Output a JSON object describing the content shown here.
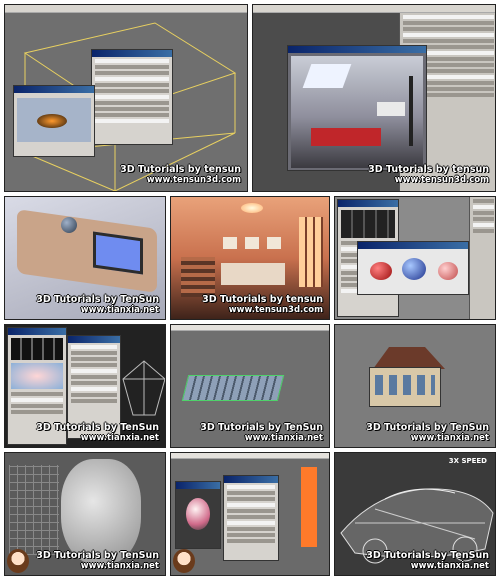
{
  "captions": {
    "t01": {
      "line1": "3D Tutorials by tensun",
      "line2": "www.tensun3d.com"
    },
    "t02": {
      "line1": "3D Tutorials by tensun",
      "line2": "www.tensun3d.com"
    },
    "t03": {
      "line1": "3D Tutorials by TenSun",
      "line2": "www.tianxia.net"
    },
    "t04": {
      "line1": "3D Tutorials by tensun",
      "line2": "www.tensun3d.com"
    },
    "t05": {
      "line1": "3D Tutorials by TenSun",
      "line2": "www.tianxia.net"
    },
    "t06": {
      "line1": "3D Tutorials by TenSun",
      "line2": "www.tianxia.net"
    },
    "t07": {
      "line1": "3D Tutorials by TenSun",
      "line2": "www.tianxia.net"
    },
    "t08": {
      "line1": "3D Tutorials by TenSun",
      "line2": "www.tianxia.net"
    },
    "t09": {
      "line1": "3D Tutorials by TenSun",
      "line2": "www.tianxia.net"
    }
  },
  "overlays": {
    "t12_viewport_label": "3X SPEED"
  },
  "colors": {
    "viewport_gray": "#8e8e8e",
    "ui_panel": "#d6d3ce",
    "titlebar": "#0a246a",
    "caption_text": "#ffffff"
  }
}
